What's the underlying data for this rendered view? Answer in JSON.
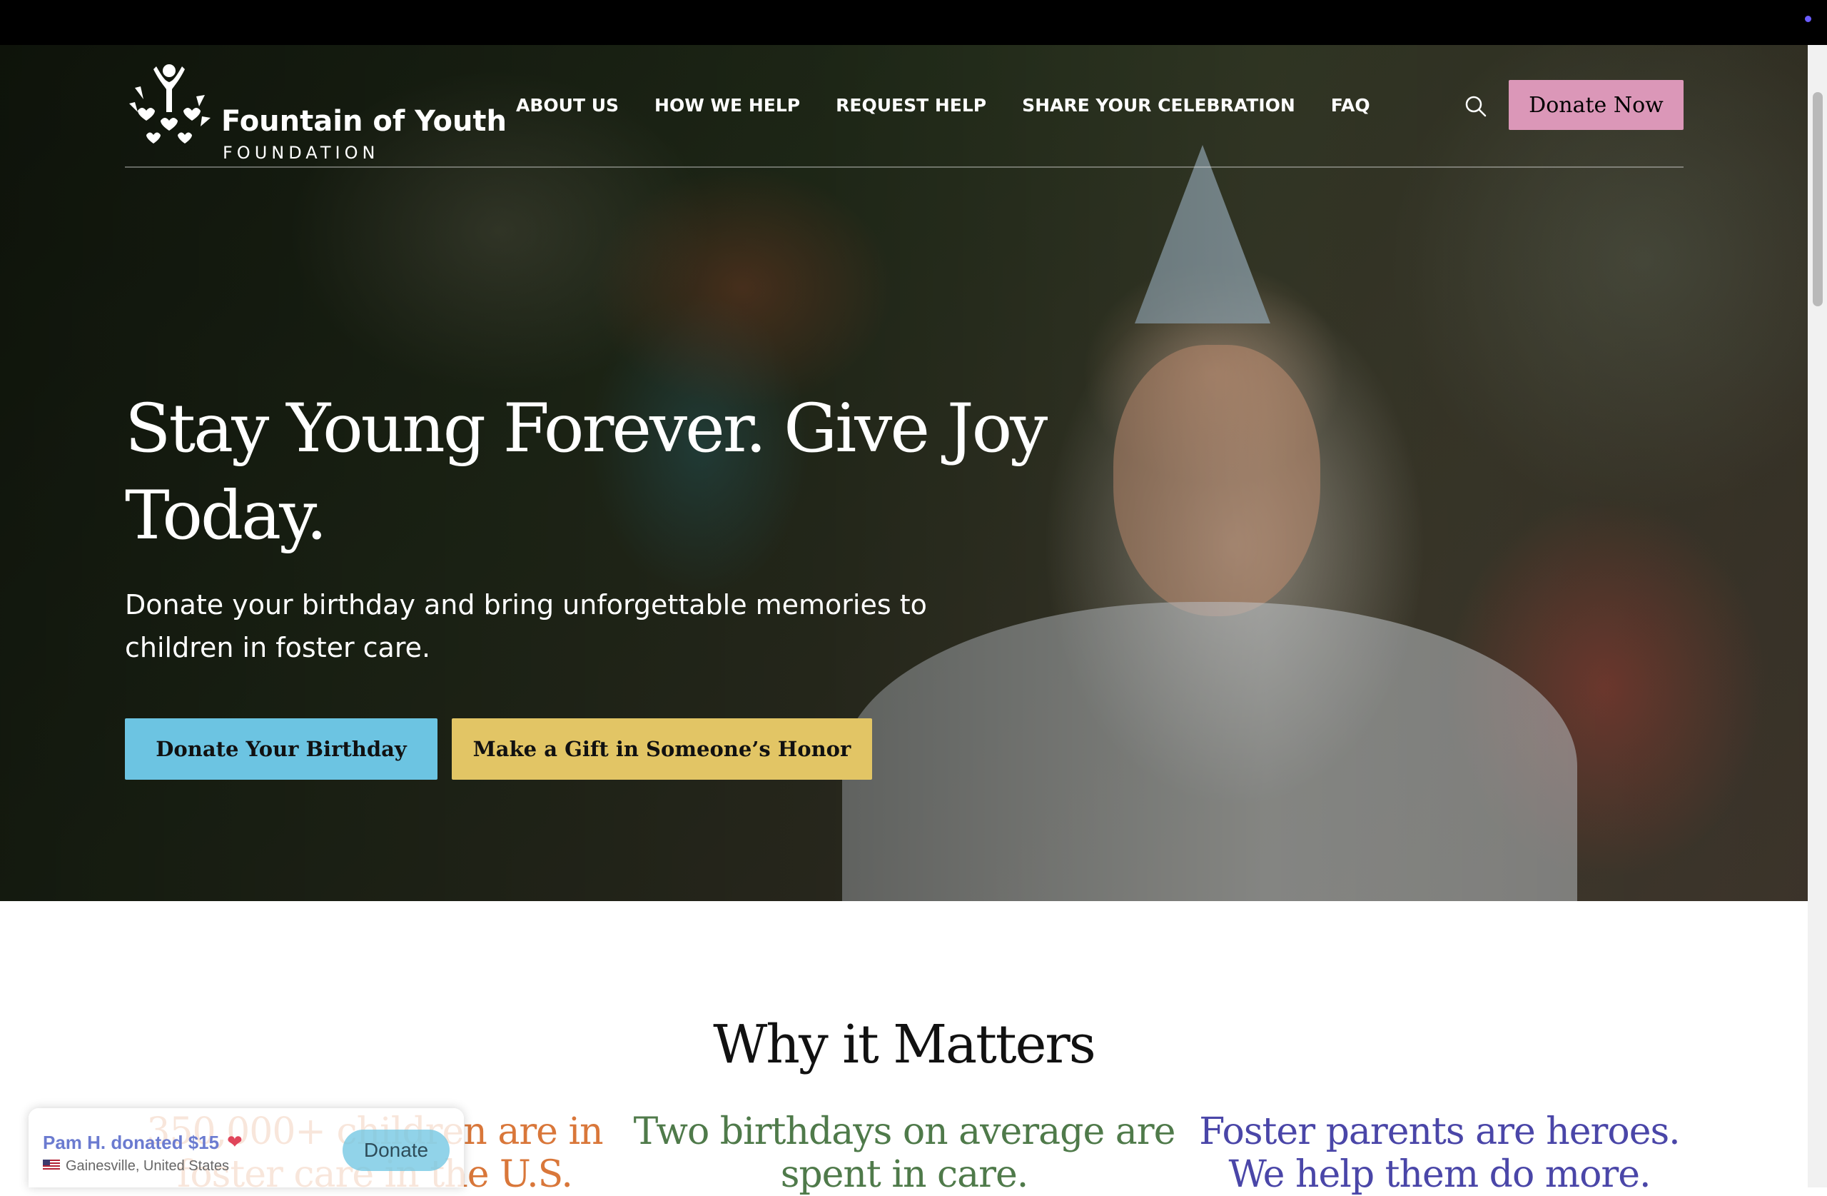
{
  "header": {
    "logo_name": "Fountain of Youth",
    "logo_sub": "FOUNDATION",
    "nav": [
      "ABOUT US",
      "HOW WE HELP",
      "REQUEST HELP",
      "SHARE YOUR CELEBRATION",
      "FAQ"
    ],
    "search_icon": "search-icon",
    "donate_label": "Donate Now"
  },
  "hero": {
    "headline": "Stay Young Forever. Give Joy Today.",
    "subhead": "Donate your birthday and bring unforgettable memories to children in foster care.",
    "primary_cta": "Donate Your Birthday",
    "secondary_cta": "Make a Gift in Someone’s Honor"
  },
  "why": {
    "title": "Why it Matters",
    "stats": [
      "350,000+ children are in foster care in the U.S.",
      "Two birthdays on average are spent in care.",
      "Foster parents are heroes. We help them do more."
    ]
  },
  "toast": {
    "text": "Pam H. donated $15",
    "heart": "❤",
    "location": "Gainesville, United States",
    "donate_label": "Donate"
  },
  "colors": {
    "donate_now": "#db97b8",
    "cta_birthday": "#6cc4e2",
    "cta_honor": "#e2c565",
    "stat_orange": "#d9773a",
    "stat_green": "#4f7a4a",
    "stat_purple": "#4a46a8"
  }
}
